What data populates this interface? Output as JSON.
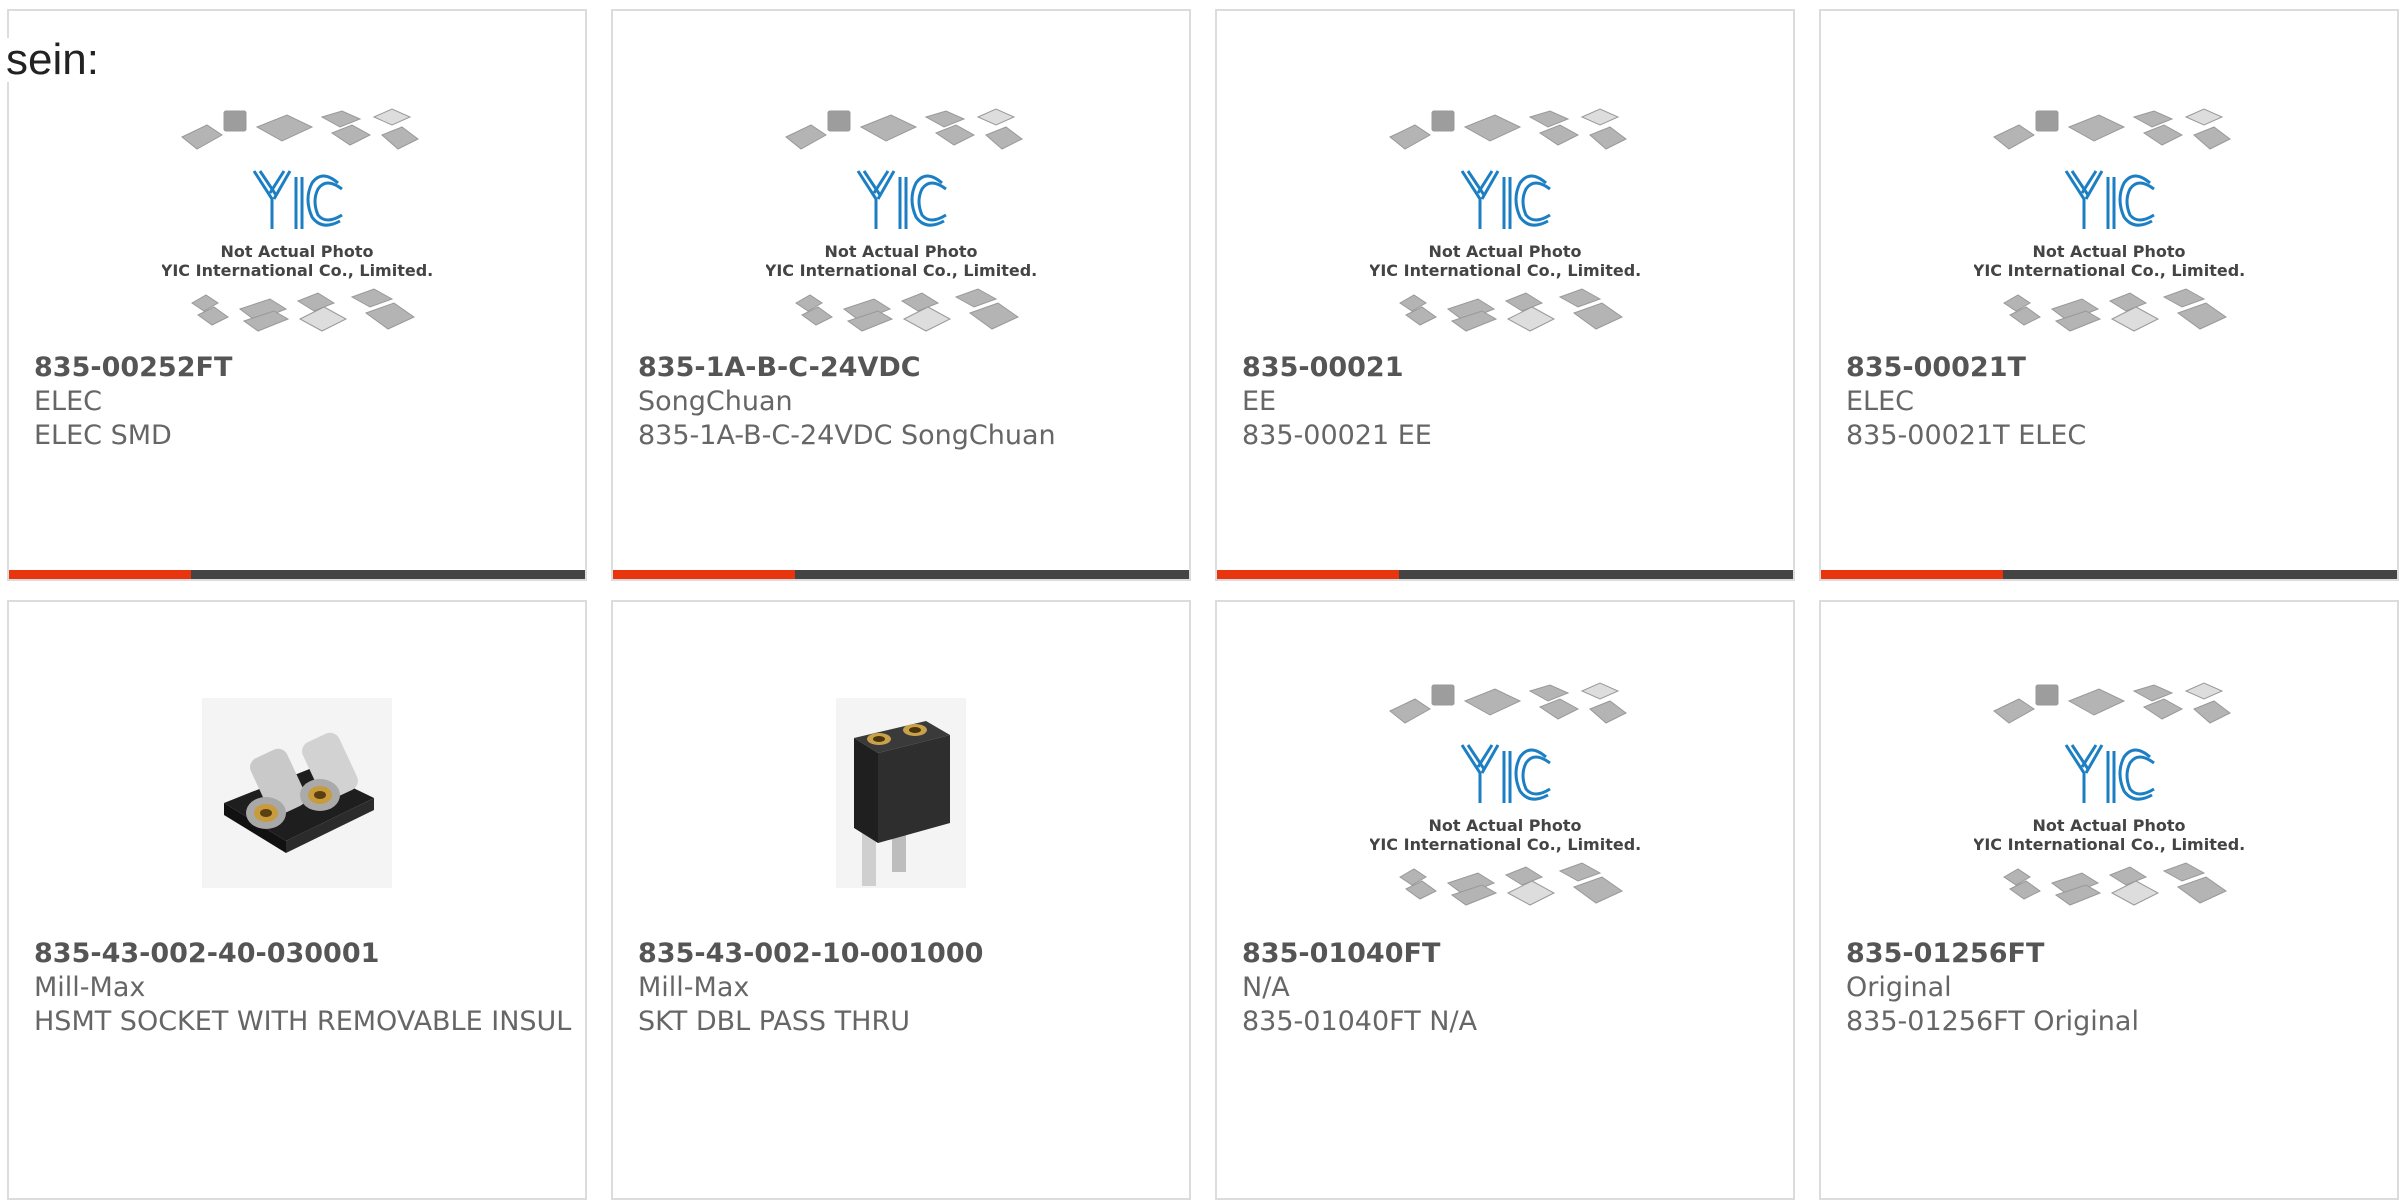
{
  "lead_text": "sein:",
  "accent_color": "#e8350e",
  "placeholder": {
    "logo": "YIC",
    "line1": "Not Actual Photo",
    "line2": "YIC International Co., Limited."
  },
  "products": [
    {
      "part": "835-00252FT",
      "manufacturer": "ELEC",
      "description": "ELEC SMD",
      "image": "placeholder-logo"
    },
    {
      "part": "835-1A-B-C-24VDC",
      "manufacturer": "SongChuan",
      "description": "835-1A-B-C-24VDC SongChuan",
      "image": "placeholder-logo"
    },
    {
      "part": "835-00021",
      "manufacturer": "EE",
      "description": "835-00021 EE",
      "image": "placeholder-logo"
    },
    {
      "part": "835-00021T",
      "manufacturer": "ELEC",
      "description": "835-00021T ELEC",
      "image": "placeholder-logo"
    },
    {
      "part": "835-43-002-40-030001",
      "manufacturer": "Mill-Max",
      "description": "HSMT SOCKET WITH REMOVABLE INSUL",
      "image": "socket-icon"
    },
    {
      "part": "835-43-002-10-001000",
      "manufacturer": "Mill-Max",
      "description": "SKT DBL PASS THRU",
      "image": "pin-socket-icon"
    },
    {
      "part": "835-01040FT",
      "manufacturer": "N/A",
      "description": "835-01040FT N/A",
      "image": "placeholder-logo"
    },
    {
      "part": "835-01256FT",
      "manufacturer": "Original",
      "description": "835-01256FT Original",
      "image": "placeholder-logo"
    }
  ]
}
